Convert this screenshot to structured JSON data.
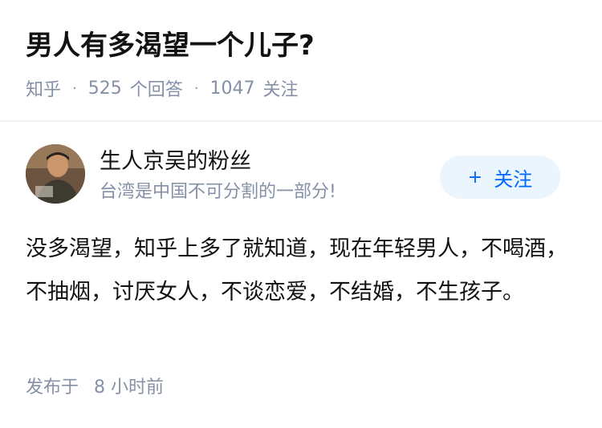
{
  "question": {
    "title": "男人有多渴望一个儿子?",
    "source": "知乎",
    "separator": "·",
    "answers_count": "525",
    "answers_label": "个回答",
    "followers_count": "1047",
    "followers_label": "关注"
  },
  "author": {
    "name": "生人京吴的粉丝",
    "bio": "台湾是中国不可分割的一部分!",
    "follow_plus": "+",
    "follow_label": "关注"
  },
  "answer": {
    "text": "没多渴望，知乎上多了就知道，现在年轻男人，不喝酒，不抽烟，讨厌女人，不谈恋爱，不结婚，不生孩子。",
    "published_label": "发布于",
    "published_time": "8 小时前"
  },
  "colors": {
    "primary_text": "#121212",
    "secondary_text": "#8590a6",
    "accent_blue": "#0066ff",
    "follow_bg": "#ebf5fd",
    "divider": "#f2f2f2"
  }
}
